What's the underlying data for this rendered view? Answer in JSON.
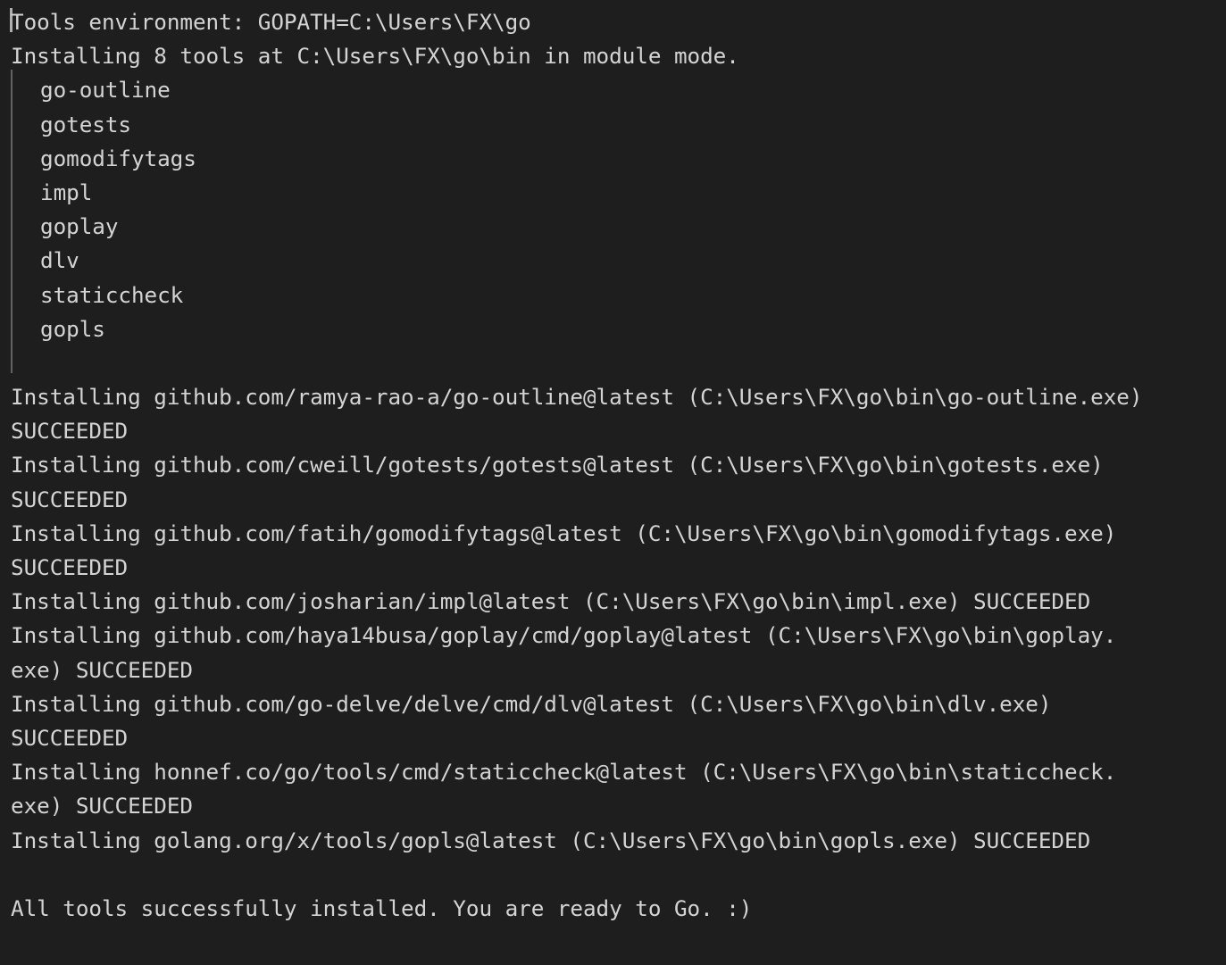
{
  "panel": {
    "name": "go-tools-install-output",
    "background_color": "#1e1e1e",
    "text_color": "#d4d4d4",
    "guide_color": "#6e6e6e",
    "caret_color": "#aeaeae"
  },
  "console": {
    "header_lines": [
      "Tools environment: GOPATH=C:\\Users\\FX\\go",
      "Installing 8 tools at C:\\Users\\FX\\go\\bin in module mode."
    ],
    "tool_list": [
      "go-outline",
      "gotests",
      "gomodifytags",
      "impl",
      "goplay",
      "dlv",
      "staticcheck",
      "gopls"
    ],
    "install_lines": [
      "Installing github.com/ramya-rao-a/go-outline@latest (C:\\Users\\FX\\go\\bin\\go-outline.exe)",
      "SUCCEEDED",
      "Installing github.com/cweill/gotests/gotests@latest (C:\\Users\\FX\\go\\bin\\gotests.exe)",
      "SUCCEEDED",
      "Installing github.com/fatih/gomodifytags@latest (C:\\Users\\FX\\go\\bin\\gomodifytags.exe)",
      "SUCCEEDED",
      "Installing github.com/josharian/impl@latest (C:\\Users\\FX\\go\\bin\\impl.exe) SUCCEEDED",
      "Installing github.com/haya14busa/goplay/cmd/goplay@latest (C:\\Users\\FX\\go\\bin\\goplay.",
      "exe) SUCCEEDED",
      "Installing github.com/go-delve/delve/cmd/dlv@latest (C:\\Users\\FX\\go\\bin\\dlv.exe)",
      "SUCCEEDED",
      "Installing honnef.co/go/tools/cmd/staticcheck@latest (C:\\Users\\FX\\go\\bin\\staticcheck.",
      "exe) SUCCEEDED",
      "Installing golang.org/x/tools/gopls@latest (C:\\Users\\FX\\go\\bin\\gopls.exe) SUCCEEDED"
    ],
    "footer_line": "All tools successfully installed. You are ready to Go. :)"
  }
}
